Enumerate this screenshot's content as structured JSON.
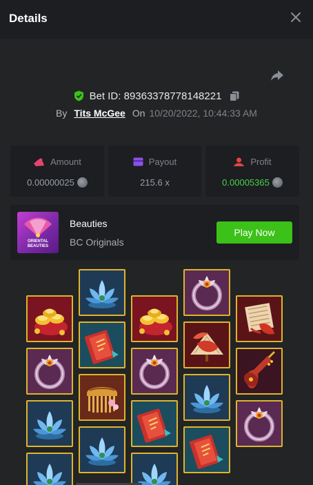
{
  "header": {
    "title": "Details"
  },
  "bet": {
    "label": "Bet ID: 89363378778148221"
  },
  "byline": {
    "by": "By",
    "user": "Tits McGee",
    "on": "On",
    "date": "10/20/2022, 10:44:33 AM"
  },
  "stats": {
    "amount": {
      "label": "Amount",
      "value": "0.00000025",
      "icon": "amount-icon"
    },
    "payout": {
      "label": "Payout",
      "value": "215.6 x",
      "icon": "wallet-icon"
    },
    "profit": {
      "label": "Profit",
      "value": "0.00005365",
      "icon": "profit-icon"
    }
  },
  "game": {
    "name": "Beauties",
    "provider": "BC Originals",
    "play_label": "Play Now",
    "thumb_text": "ORIENTAL BEAUTIES"
  },
  "colors": {
    "accent_green": "#3bc117",
    "profit_green": "#47d14b",
    "tile_border": "#e0b52c"
  },
  "reels": [
    [
      "gold-ingots",
      "lotus-ring",
      "lotus",
      "lotus"
    ],
    [
      "lotus",
      "red-book",
      "hair-comb",
      "lotus"
    ],
    [
      "gold-ingots",
      "lotus-ring",
      "red-book",
      "lotus"
    ],
    [
      "lotus-ring",
      "koi-fan",
      "lotus",
      "red-book"
    ],
    [
      "paper-fan",
      "pipa",
      "lotus-ring"
    ]
  ]
}
